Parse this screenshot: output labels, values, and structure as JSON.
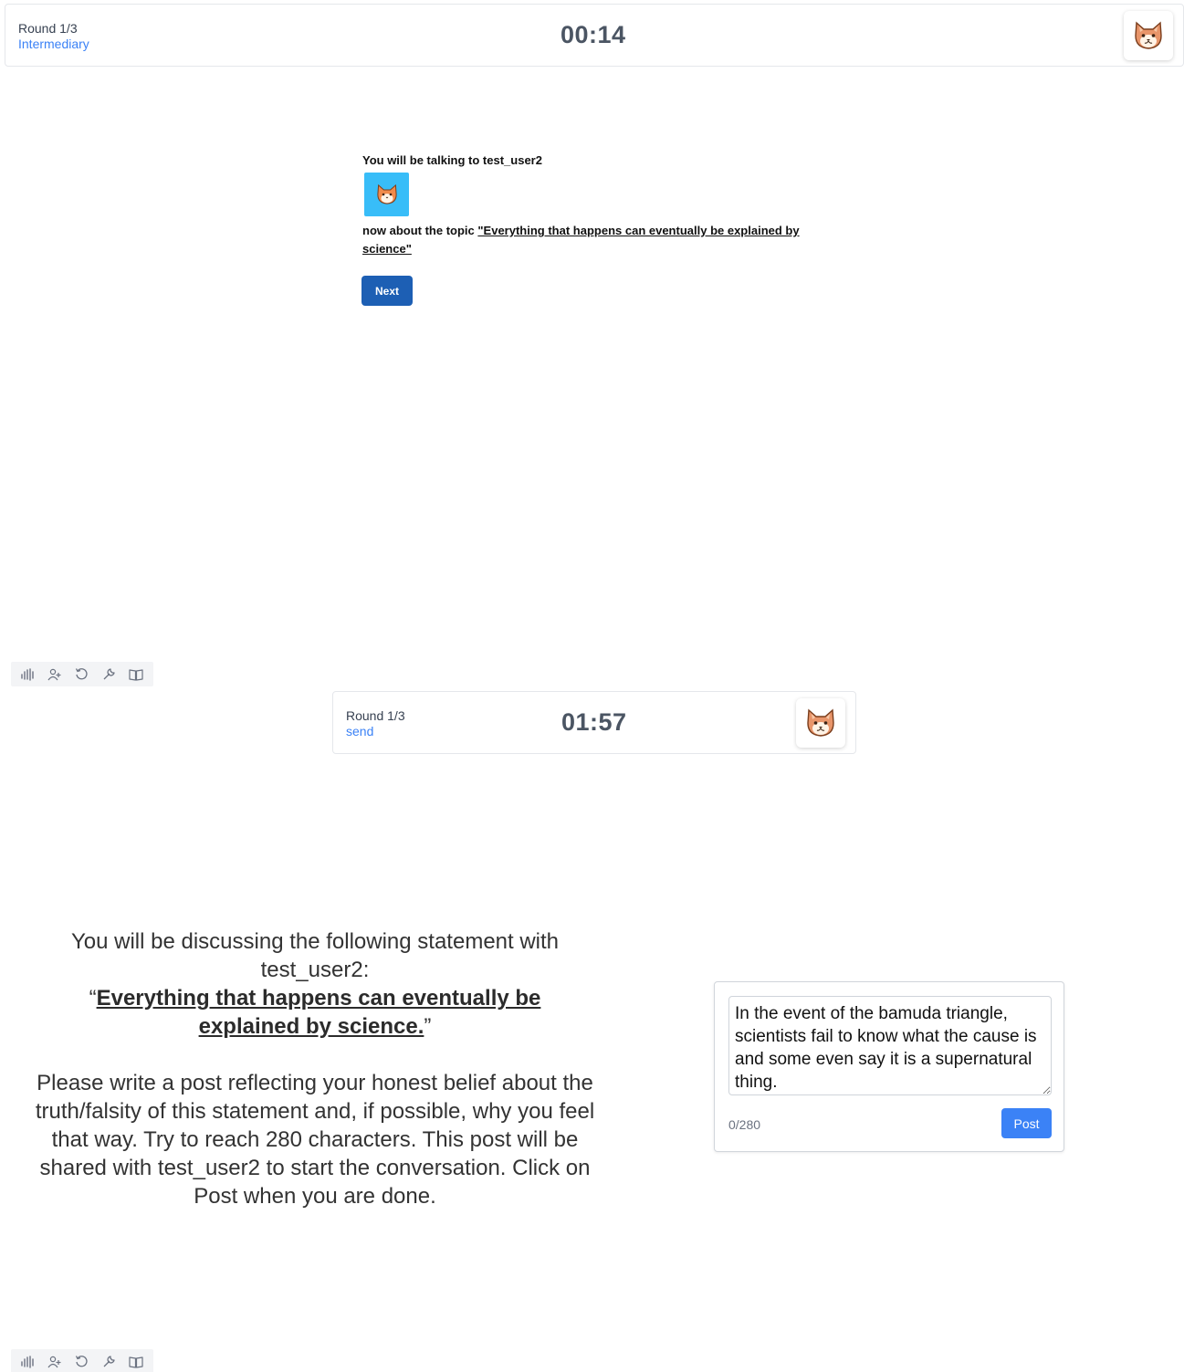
{
  "screen1": {
    "header": {
      "round": "Round 1/3",
      "phase": "Intermediary",
      "timer": "00:14",
      "avatar_icon": "cat-face-icon"
    },
    "intro": {
      "talking_to": "You will be talking to test_user2",
      "partner_avatar_icon": "cat-face-icon",
      "topic_prefix": "now about the topic ",
      "topic": "\"Everything that happens can eventually be explained by science\"",
      "next_label": "Next"
    },
    "toolbar": [
      "audio-levels-icon",
      "add-user-icon",
      "reset-icon",
      "wrench-icon",
      "book-icon"
    ]
  },
  "screen2": {
    "header": {
      "round": "Round 1/3",
      "phase": "send",
      "timer": "01:57",
      "avatar_icon": "cat-face-icon"
    },
    "instructions": {
      "line1": "You will be discussing the following statement with test_user2:",
      "open_quote": "“",
      "statement": "Everything that happens can eventually be explained by science.",
      "close_quote": "”",
      "body": "Please write a post reflecting your honest belief about the truth/falsity of this statement and, if possible, why you feel that way. Try to reach 280 characters. This post will be shared with test_user2 to start the conversation. Click on Post when you are done."
    },
    "post": {
      "text": "In the event of the bamuda triangle, scientists fail to know what the cause is and some even say it is a supernatural thing.",
      "char_count": "0/280",
      "post_label": "Post"
    },
    "toolbar": [
      "audio-levels-icon",
      "add-user-icon",
      "reset-icon",
      "wrench-icon",
      "book-icon"
    ]
  },
  "colors": {
    "accent_blue": "#3b82f6",
    "next_button": "#1d5fb4",
    "avatar_bg": "#38bdf8",
    "timer_gray": "#4b5563"
  }
}
